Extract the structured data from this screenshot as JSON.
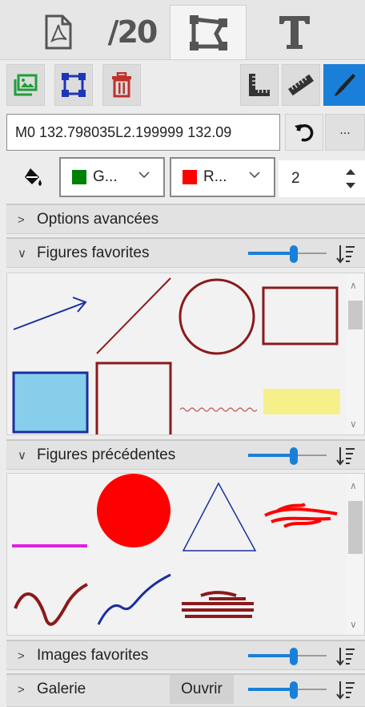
{
  "tabs": [
    {
      "name": "pdf-tab",
      "icon": "pdf-file-icon"
    },
    {
      "name": "page-count-tab",
      "label": "/20"
    },
    {
      "name": "shape-tab",
      "icon": "shape-select-icon",
      "active": true
    },
    {
      "name": "text-tab",
      "icon": "text-T-icon"
    }
  ],
  "toolbar": {
    "left": [
      "image-icon",
      "selection-box-icon",
      "trash-icon"
    ],
    "right": [
      "ruler-square-icon",
      "ruler-icon",
      "pen-icon"
    ],
    "active": "pen-icon"
  },
  "path": {
    "value": "M0 132.798035L2.199999 132.09"
  },
  "colors": {
    "fill_icon": "paint-bucket-icon",
    "fill_label": "G...",
    "fill_color": "#008000",
    "stroke_label": "R...",
    "stroke_color": "#ff0000",
    "width_value": "2"
  },
  "sections": {
    "advanced": {
      "label": "Options avancées",
      "expanded": false
    },
    "favorites": {
      "label": "Figures favorites",
      "expanded": true,
      "slider": 0.6
    },
    "previous": {
      "label": "Figures précédentes",
      "expanded": true,
      "slider": 0.6
    },
    "images": {
      "label": "Images favorites",
      "expanded": false,
      "slider": 0.6
    },
    "gallery": {
      "label": "Galerie",
      "expanded": false,
      "open_label": "Ouvrir",
      "slider": 0.6
    }
  },
  "more_label": "...",
  "accent": "#1a7fd8"
}
